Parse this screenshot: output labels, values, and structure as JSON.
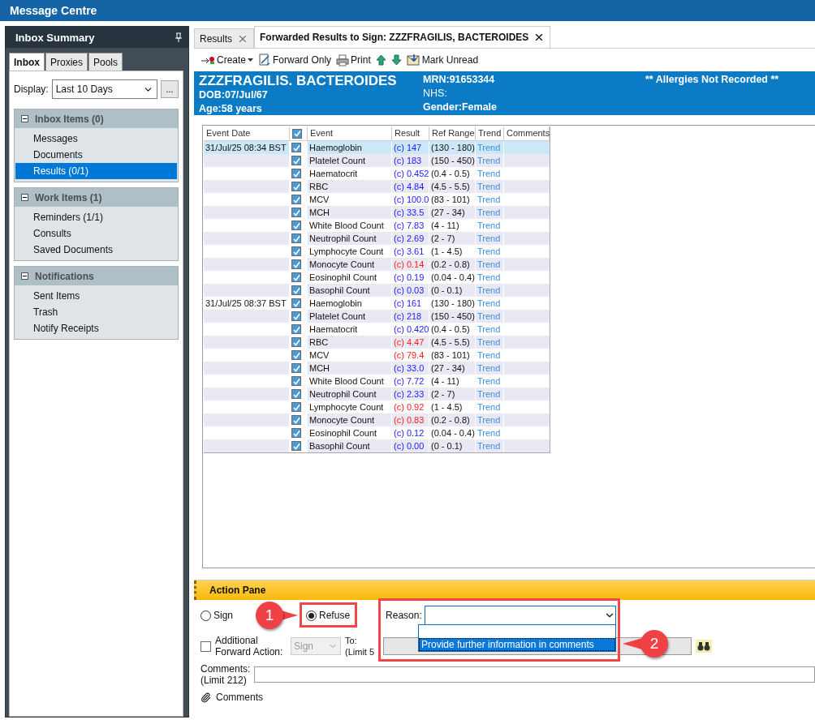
{
  "window": {
    "title": "Message Centre"
  },
  "sidebar": {
    "title": "Inbox Summary",
    "tabs": [
      {
        "label": "Inbox",
        "selected": true
      },
      {
        "label": "Proxies",
        "selected": false
      },
      {
        "label": "Pools",
        "selected": false
      }
    ],
    "display_label": "Display:",
    "display_value": "Last 10 Days",
    "more_button": "...",
    "sections": [
      {
        "title": "Inbox Items (0)",
        "expanded": true,
        "items": [
          {
            "label": "Messages",
            "selected": false
          },
          {
            "label": "Documents",
            "selected": false
          },
          {
            "label": "Results (0/1)",
            "selected": true
          }
        ]
      },
      {
        "title": "Work Items (1)",
        "expanded": true,
        "items": [
          {
            "label": "Reminders (1/1)",
            "selected": false
          },
          {
            "label": "Consults",
            "selected": false
          },
          {
            "label": "Saved Documents",
            "selected": false
          }
        ]
      },
      {
        "title": "Notifications",
        "expanded": true,
        "items": [
          {
            "label": "Sent Items",
            "selected": false
          },
          {
            "label": "Trash",
            "selected": false
          },
          {
            "label": "Notify Receipts",
            "selected": false
          }
        ]
      }
    ]
  },
  "tabs": [
    {
      "label": "Results",
      "selected": false
    },
    {
      "label": "Forwarded Results to Sign: ZZZFRAGILIS, BACTEROIDES",
      "selected": true
    }
  ],
  "toolbar": [
    {
      "kind": "create",
      "label": "Create"
    },
    {
      "kind": "forward",
      "label": "Forward Only"
    },
    {
      "kind": "print",
      "label": "Print"
    },
    {
      "kind": "up"
    },
    {
      "kind": "down"
    },
    {
      "kind": "unread",
      "label": "Mark Unread"
    }
  ],
  "patient": {
    "name": "ZZZFRAGILIS. BACTEROIDES",
    "dob": "DOB:07/Jul/67",
    "age": "Age:58 years",
    "mrn": "MRN:91653344",
    "nhs": "NHS:",
    "gender": "Gender:Female",
    "allergies": "** Allergies Not Recorded **"
  },
  "table": {
    "columns": [
      "Event Date",
      "Event",
      "Result",
      "Ref Range",
      "Trend",
      "Comments"
    ],
    "all_checked": true,
    "groups": [
      {
        "date": "31/Jul/25 08:34 BST",
        "rows": [
          {
            "event": "Haemoglobin",
            "checked": true,
            "selected": true,
            "result": "(c) 147",
            "abnormal": false,
            "range": "(130 - 180)",
            "trend": "Trend"
          },
          {
            "event": "Platelet Count",
            "checked": true,
            "selected": false,
            "result": "(c) 183",
            "abnormal": false,
            "range": "(150 - 450)",
            "trend": "Trend"
          },
          {
            "event": "Haematocrit",
            "checked": true,
            "selected": false,
            "result": "(c) 0.452",
            "abnormal": false,
            "range": "(0.4 - 0.5)",
            "trend": "Trend"
          },
          {
            "event": "RBC",
            "checked": true,
            "selected": false,
            "result": "(c) 4.84",
            "abnormal": false,
            "range": "(4.5 - 5.5)",
            "trend": "Trend"
          },
          {
            "event": "MCV",
            "checked": true,
            "selected": false,
            "result": "(c) 100.0",
            "abnormal": false,
            "range": "(83 - 101)",
            "trend": "Trend"
          },
          {
            "event": "MCH",
            "checked": true,
            "selected": false,
            "result": "(c) 33.5",
            "abnormal": false,
            "range": "(27 - 34)",
            "trend": "Trend"
          },
          {
            "event": "White Blood Count",
            "checked": true,
            "selected": false,
            "result": "(c) 7.83",
            "abnormal": false,
            "range": "(4 - 11)",
            "trend": "Trend"
          },
          {
            "event": "Neutrophil Count",
            "checked": true,
            "selected": false,
            "result": "(c) 2.69",
            "abnormal": false,
            "range": "(2 - 7)",
            "trend": "Trend"
          },
          {
            "event": "Lymphocyte Count",
            "checked": true,
            "selected": false,
            "result": "(c) 3.61",
            "abnormal": false,
            "range": "(1 - 4.5)",
            "trend": "Trend"
          },
          {
            "event": "Monocyte Count",
            "checked": true,
            "selected": false,
            "result": "(c) 0.14",
            "abnormal": true,
            "range": "(0.2 - 0.8)",
            "trend": "Trend"
          },
          {
            "event": "Eosinophil Count",
            "checked": true,
            "selected": false,
            "result": "(c) 0.19",
            "abnormal": false,
            "range": "(0.04 - 0.4)",
            "trend": "Trend"
          },
          {
            "event": "Basophil Count",
            "checked": true,
            "selected": false,
            "result": "(c) 0.03",
            "abnormal": false,
            "range": "(0 - 0.1)",
            "trend": "Trend"
          }
        ]
      },
      {
        "date": "31/Jul/25 08:37 BST",
        "rows": [
          {
            "event": "Haemoglobin",
            "checked": true,
            "selected": false,
            "result": "(c) 161",
            "abnormal": false,
            "range": "(130 - 180)",
            "trend": "Trend"
          },
          {
            "event": "Platelet Count",
            "checked": true,
            "selected": false,
            "result": "(c) 218",
            "abnormal": false,
            "range": "(150 - 450)",
            "trend": "Trend"
          },
          {
            "event": "Haematocrit",
            "checked": true,
            "selected": false,
            "result": "(c) 0.420",
            "abnormal": false,
            "range": "(0.4 - 0.5)",
            "trend": "Trend"
          },
          {
            "event": "RBC",
            "checked": true,
            "selected": false,
            "result": "(c) 4.47",
            "abnormal": true,
            "range": "(4.5 - 5.5)",
            "trend": "Trend"
          },
          {
            "event": "MCV",
            "checked": true,
            "selected": false,
            "result": "(c) 79.4",
            "abnormal": true,
            "range": "(83 - 101)",
            "trend": "Trend"
          },
          {
            "event": "MCH",
            "checked": true,
            "selected": false,
            "result": "(c) 33.0",
            "abnormal": false,
            "range": "(27 - 34)",
            "trend": "Trend"
          },
          {
            "event": "White Blood Count",
            "checked": true,
            "selected": false,
            "result": "(c) 7.72",
            "abnormal": false,
            "range": "(4 - 11)",
            "trend": "Trend"
          },
          {
            "event": "Neutrophil Count",
            "checked": true,
            "selected": false,
            "result": "(c) 2.33",
            "abnormal": false,
            "range": "(2 - 7)",
            "trend": "Trend"
          },
          {
            "event": "Lymphocyte Count",
            "checked": true,
            "selected": false,
            "result": "(c) 0.92",
            "abnormal": true,
            "range": "(1 - 4.5)",
            "trend": "Trend"
          },
          {
            "event": "Monocyte Count",
            "checked": true,
            "selected": false,
            "result": "(c) 0.83",
            "abnormal": true,
            "range": "(0.2 - 0.8)",
            "trend": "Trend"
          },
          {
            "event": "Eosinophil Count",
            "checked": true,
            "selected": false,
            "result": "(c) 0.12",
            "abnormal": false,
            "range": "(0.04 - 0.4)",
            "trend": "Trend"
          },
          {
            "event": "Basophil Count",
            "checked": true,
            "selected": false,
            "result": "(c) 0.00",
            "abnormal": false,
            "range": "(0 - 0.1)",
            "trend": "Trend"
          }
        ]
      }
    ]
  },
  "action_pane": {
    "title": "Action Pane",
    "decision": [
      {
        "label": "Sign",
        "selected": false
      },
      {
        "label": "Refuse",
        "selected": true
      }
    ],
    "reason_label": "Reason:",
    "reason_options": [
      {
        "label": "Provide further information in comments",
        "selected": true
      }
    ],
    "forward": {
      "label": "Additional Forward Action:",
      "checked": false,
      "action": "Sign",
      "disabled": true,
      "to_label": "To:",
      "limit": "(Limit 5"
    },
    "comments_label": "Comments:",
    "comments_limit": "(Limit 212)",
    "attachment": "Comments"
  },
  "callouts": [
    "1",
    "2"
  ]
}
